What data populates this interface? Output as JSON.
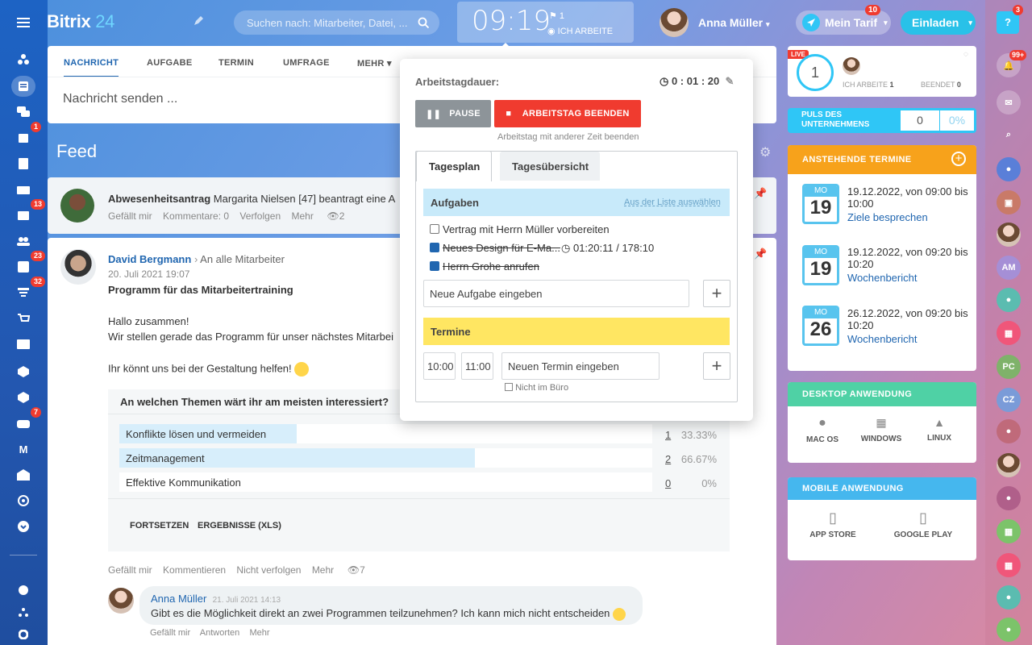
{
  "header": {
    "logo_main": "Bitrix",
    "logo_num": "24",
    "search_placeholder": "Suchen nach: Mitarbeiter, Datei, ...",
    "clock": "09:19",
    "flag_count": "1",
    "status": "ICH ARBEITE",
    "user_name": "Anna Müller",
    "tarif": "Mein Tarif",
    "tarif_badge": "10",
    "invite": "Einladen",
    "help_badge": "3",
    "notif_badge": "99+"
  },
  "sidebar": {
    "badges": [
      "1",
      "13",
      "23",
      "32",
      "7"
    ],
    "letter_m": "M"
  },
  "composer": {
    "tabs": [
      "NACHRICHT",
      "AUFGABE",
      "TERMIN",
      "UMFRAGE",
      "MEHR"
    ],
    "placeholder": "Nachricht senden ..."
  },
  "feed": {
    "title": "Feed"
  },
  "absence": {
    "title": "Abwesenheitsantrag",
    "text": "Margarita Nielsen [47] beantragt eine A",
    "actions": [
      "Gefällt mir",
      "Kommentare: 0",
      "Verfolgen",
      "Mehr"
    ],
    "views": "2"
  },
  "post": {
    "author": "David Bergmann",
    "audience": "An alle Mitarbeiter",
    "date": "20. Juli 2021 19:07",
    "title": "Programm für das Mitarbeitertraining",
    "line1": "Hallo zusammen!",
    "line2": "Wir stellen gerade das Programm für unser nächstes Mitarbei",
    "line3": "Ihr könnt uns bei der Gestaltung helfen!",
    "poll": {
      "question": "An welchen Themen wärt ihr am meisten interessiert?",
      "options": [
        {
          "label": "Konflikte lösen und vermeiden",
          "count": "1",
          "pct": "33.33%",
          "fill": 0.333
        },
        {
          "label": "Zeitmanagement",
          "count": "2",
          "pct": "66.67%",
          "fill": 0.667
        },
        {
          "label": "Effektive Kommunikation",
          "count": "0",
          "pct": "0%",
          "fill": 0
        }
      ],
      "btn_continue": "FORTSETZEN",
      "btn_results": "ERGEBNISSE (XLS)"
    },
    "actions": [
      "Gefällt mir",
      "Kommentieren",
      "Nicht verfolgen",
      "Mehr"
    ],
    "views": "7"
  },
  "comment": {
    "author": "Anna Müller",
    "date": "21. Juli 2021 14:13",
    "text": "Gibt es die Möglichkeit direkt an zwei Programmen teilzunehmen? Ich kann mich nicht entscheiden",
    "actions": [
      "Gefällt mir",
      "Antworten",
      "Mehr"
    ]
  },
  "popup": {
    "label": "Arbeitstagdauer:",
    "duration": "0 : 01 : 20",
    "pause": "PAUSE",
    "end": "ARBEITSTAG BEENDEN",
    "end_other": "Arbeitstag mit anderer Zeit beenden",
    "tab1": "Tagesplan",
    "tab2": "Tagesübersicht",
    "tasks_title": "Aufgaben",
    "tasks_link": "Aus der Liste auswählen",
    "tasks": [
      {
        "label": "Vertrag mit Herrn Müller vorbereiten",
        "done": false
      },
      {
        "label": "Neues Design für E-Ma...",
        "done": true,
        "time": "01:20:11 / 178:10"
      },
      {
        "label": "Herrn Grohe anrufen",
        "done": true
      }
    ],
    "new_task": "Neue Aufgabe eingeben",
    "events_title": "Termine",
    "from": "10:00",
    "to": "11:00",
    "new_event": "Neuen Termin eingeben",
    "not_in_office": "Nicht im Büro"
  },
  "live": {
    "badge": "LIVE",
    "count": "1",
    "working_label": "ICH ARBEITE",
    "working": "1",
    "done_label": "BEENDET",
    "done": "0"
  },
  "pulse": {
    "label1": "PULS DES",
    "label2": "UNTERNEHMENS",
    "value": "0",
    "pct": "0%"
  },
  "events": {
    "title": "ANSTEHENDE TERMINE",
    "items": [
      {
        "month": "MO",
        "day": "19",
        "when": "19.12.2022, von 09:00 bis 10:00",
        "name": "Ziele besprechen"
      },
      {
        "month": "MO",
        "day": "19",
        "when": "19.12.2022, von 09:20 bis 10:20",
        "name": "Wochenbericht"
      },
      {
        "month": "MO",
        "day": "26",
        "when": "26.12.2022, von 09:20 bis 10:20",
        "name": "Wochenbericht"
      }
    ]
  },
  "desktop": {
    "title": "DESKTOP ANWENDUNG",
    "items": [
      "MAC OS",
      "WINDOWS",
      "LINUX"
    ]
  },
  "mobile": {
    "title": "MOBILE ANWENDUNG",
    "items": [
      "APP STORE",
      "GOOGLE PLAY"
    ]
  },
  "rightbar": {
    "initials": [
      "AM",
      "PC",
      "CZ"
    ]
  },
  "colors": {
    "accent": "#2066b0",
    "primary": "#2fc6f6",
    "danger": "#f03b2f",
    "orange": "#f7a21b",
    "green": "#4fd1a5",
    "yellow": "#ffe662"
  }
}
